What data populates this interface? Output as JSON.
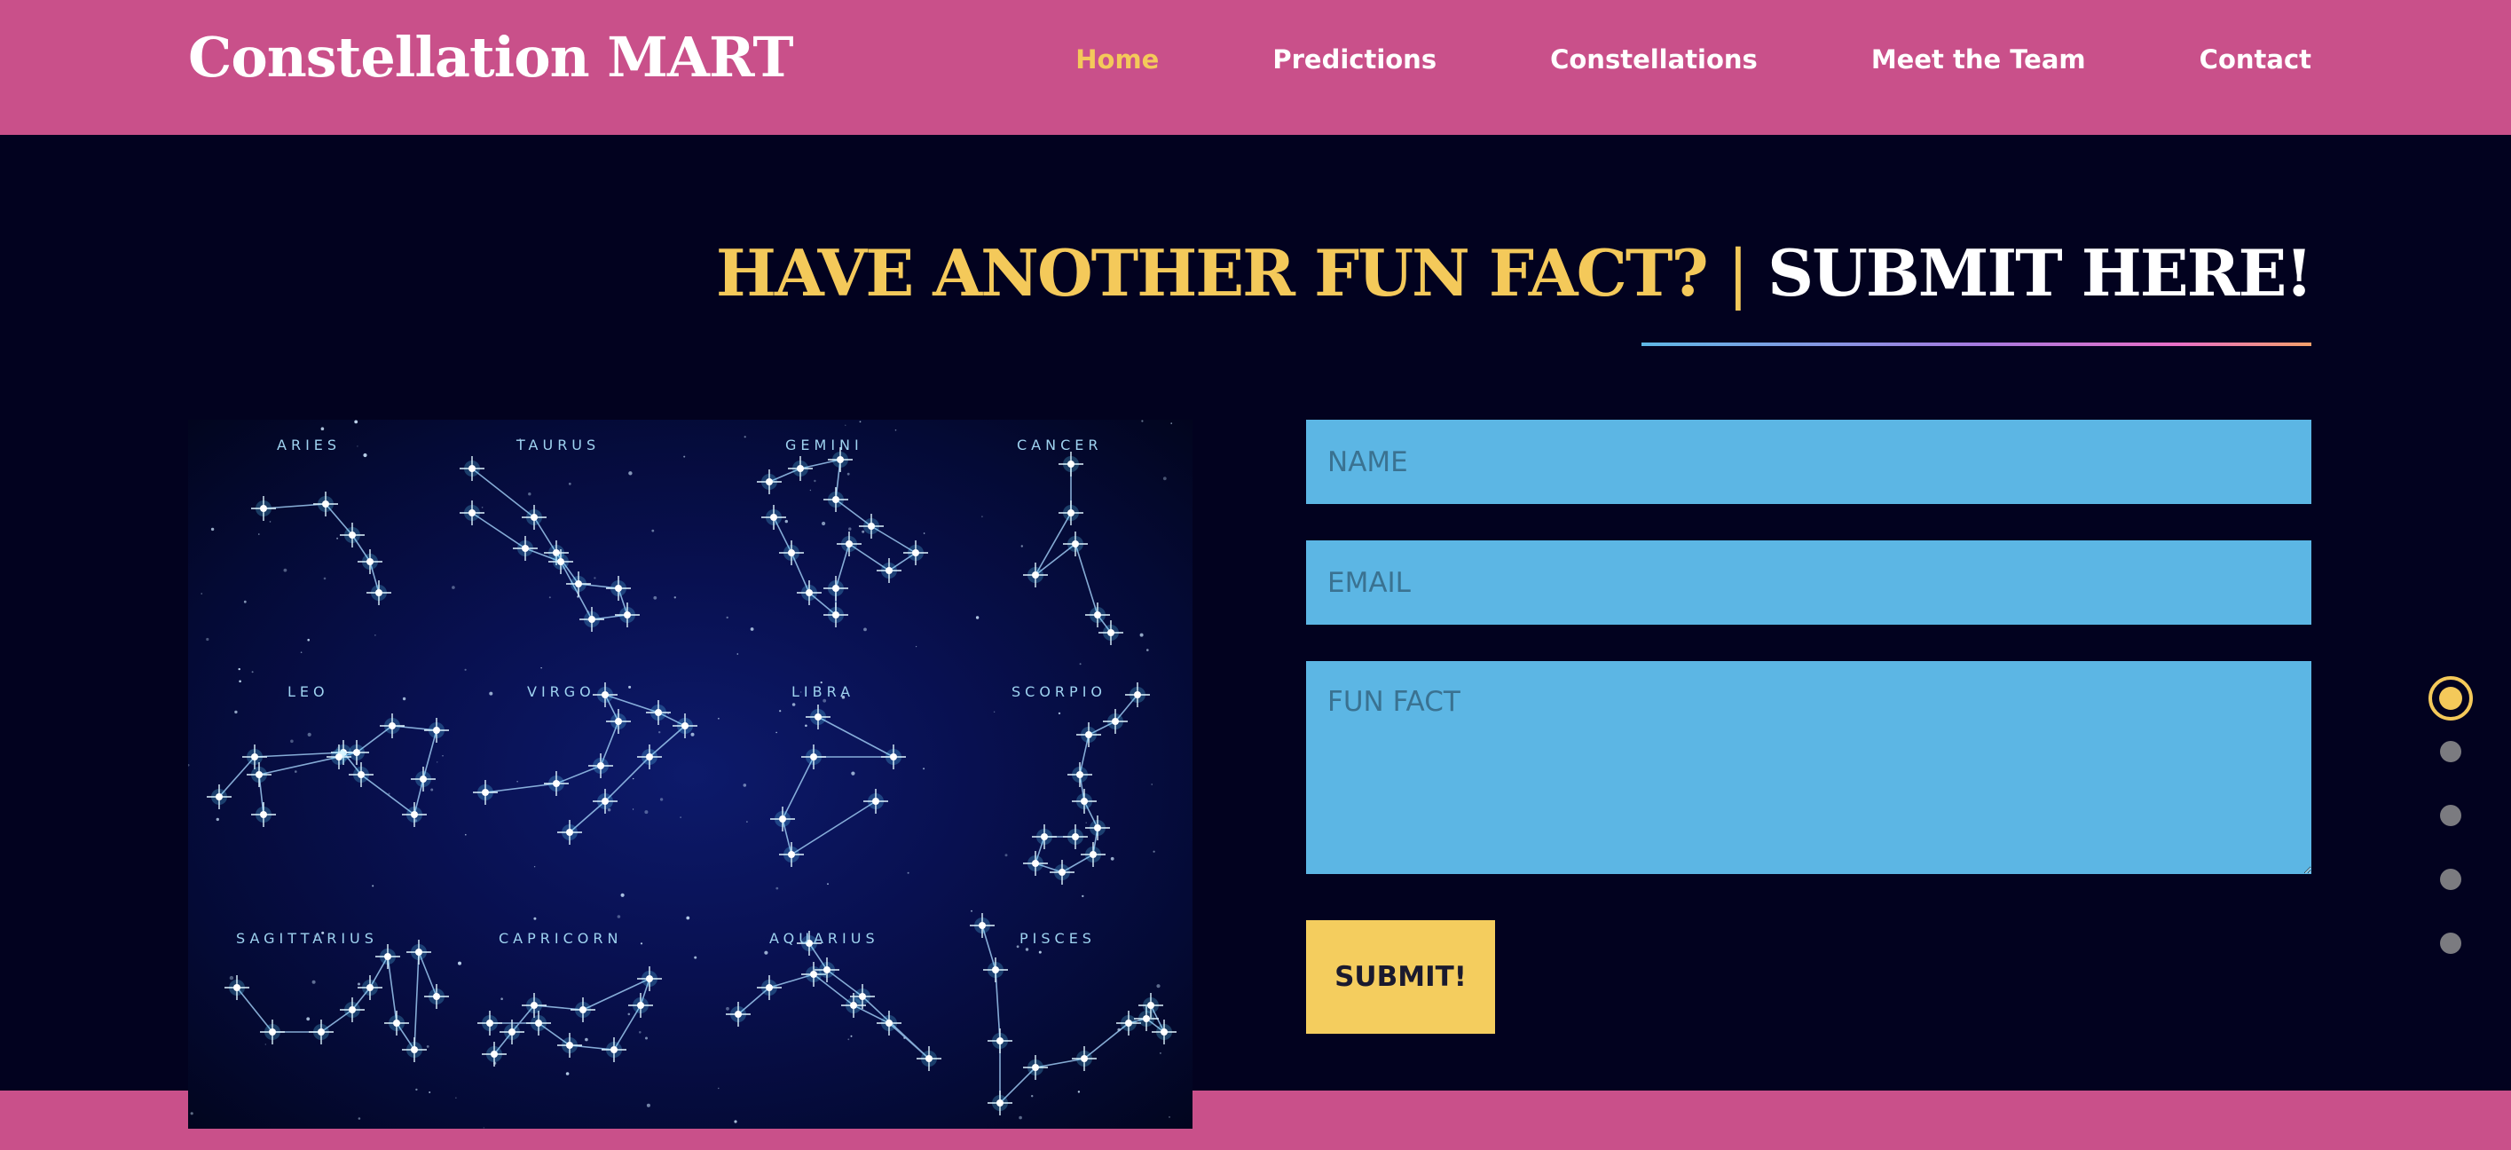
{
  "header": {
    "brand": "Constellation MART",
    "nav": [
      {
        "label": "Home",
        "active": true
      },
      {
        "label": "Predictions",
        "active": false
      },
      {
        "label": "Constellations",
        "active": false
      },
      {
        "label": "Meet the Team",
        "active": false
      },
      {
        "label": "Contact",
        "active": false
      }
    ]
  },
  "main": {
    "heading_part1": "HAVE ANOTHER FUN FACT?",
    "heading_separator": "|",
    "heading_part2": "SUBMIT HERE!",
    "image": {
      "constellations": [
        "ARIES",
        "TAURUS",
        "GEMINI",
        "CANCER",
        "LEO",
        "VIRGO",
        "LIBRA",
        "SCORPIO",
        "SAGITTARIUS",
        "CAPRICORN",
        "AQUARIUS",
        "PISCES"
      ]
    },
    "form": {
      "name_placeholder": "NAME",
      "email_placeholder": "EMAIL",
      "fact_placeholder": "FUN FACT",
      "submit_label": "SUBMIT!"
    }
  },
  "pager": {
    "count": 5,
    "active_index": 0
  },
  "colors": {
    "header_bg": "#c9508a",
    "page_bg": "#02021f",
    "accent_yellow": "#f4c95a",
    "field_blue": "#5cb6e4"
  }
}
